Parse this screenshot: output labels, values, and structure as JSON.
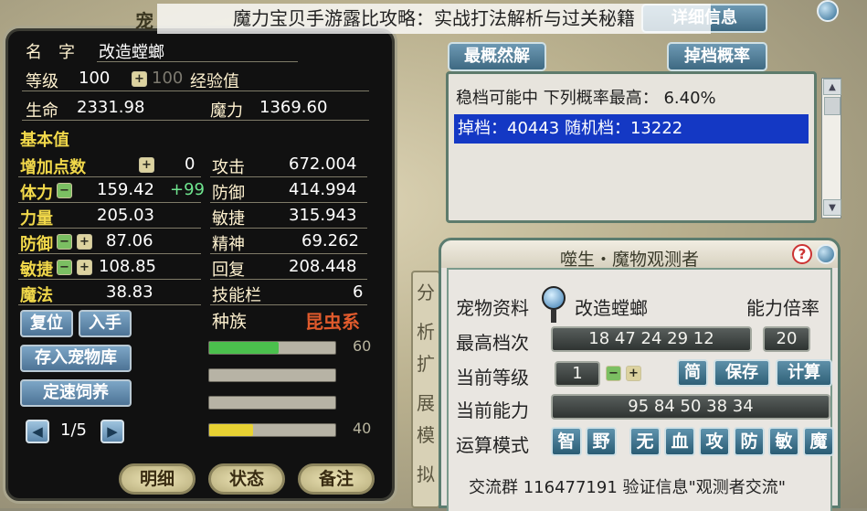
{
  "caption": "魔力宝贝手游露比攻略：实战打法解析与过关秘籍",
  "left": {
    "title_partial": "宠",
    "name_label": "名　字",
    "name_value": "改造螳螂",
    "level_label": "等级",
    "level_value": "100",
    "level_cap": "100",
    "exp_label": "经验值",
    "hp_label": "生命",
    "hp_value": "2331.98",
    "mp_label": "魔力",
    "mp_value": "1369.60",
    "base_header": "基本值",
    "base_rows": [
      {
        "label": "增加点数",
        "value": "0",
        "bonus": ""
      },
      {
        "label": "体力",
        "value": "159.42",
        "bonus": "+99"
      },
      {
        "label": "力量",
        "value": "205.03",
        "bonus": ""
      },
      {
        "label": "防御",
        "value": "87.06",
        "bonus": ""
      },
      {
        "label": "敏捷",
        "value": "108.85",
        "bonus": ""
      },
      {
        "label": "魔法",
        "value": "38.83",
        "bonus": ""
      }
    ],
    "stat_rows": [
      {
        "label": "攻击",
        "value": "672.004"
      },
      {
        "label": "防御",
        "value": "414.994"
      },
      {
        "label": "敏捷",
        "value": "315.943"
      },
      {
        "label": "精神",
        "value": "69.262"
      },
      {
        "label": "回复",
        "value": "208.448"
      },
      {
        "label": "技能栏",
        "value": "6"
      }
    ],
    "race_label": "种族",
    "race_value": "昆虫系",
    "buttons": {
      "reset": "复位",
      "obtain": "入手",
      "deposit": "存入宠物库",
      "feed": "定速饲养"
    },
    "page": "1/5",
    "bars": [
      {
        "fill": 0.55,
        "color": "#4bc04d",
        "value": "60"
      },
      {
        "fill": 0.0,
        "color": "#4bc04d",
        "value": ""
      },
      {
        "fill": 0.0,
        "color": "#4bc04d",
        "value": ""
      },
      {
        "fill": 0.35,
        "color": "#e8d233",
        "value": "40"
      }
    ],
    "tabs": [
      "明细",
      "状态",
      "备注"
    ]
  },
  "right_top": {
    "detail_button": "详细信息",
    "optimal_button": "最概然解",
    "drop_button": "掉档概率",
    "line1": "稳档可能中 下列概率最高： 6.40%",
    "line2": "掉档：40443 随机档：13222"
  },
  "right_bottom": {
    "title": "噬生・魔物观测者",
    "help_icon": "?",
    "side_tabs": [
      "分",
      "析",
      "扩",
      "展",
      "模",
      "拟"
    ],
    "pet_info_label": "宠物资料",
    "pet_name": "改造螳螂",
    "ability_multiplier_label": "能力倍率",
    "max_grade_label": "最高档次",
    "max_grade_value": "18 47 24 29 12",
    "max_grade_total": "20",
    "current_level_label": "当前等级",
    "current_level_value": "1",
    "simple_button": "简",
    "save_button": "保存",
    "calc_button": "计算",
    "current_ability_label": "当前能力",
    "current_ability_value": "95 84 50 38 34",
    "mode_label": "运算模式",
    "modes": [
      "智",
      "野",
      "无",
      "血",
      "攻",
      "防",
      "敏",
      "魔"
    ],
    "footer": "交流群 116477191 验证信息\"观测者交流\""
  },
  "colors": {
    "left_bg": "#111111",
    "accent_yellow": "#f1d84a",
    "selection_blue": "#1438c4",
    "panel_border": "#5b7c6f"
  }
}
